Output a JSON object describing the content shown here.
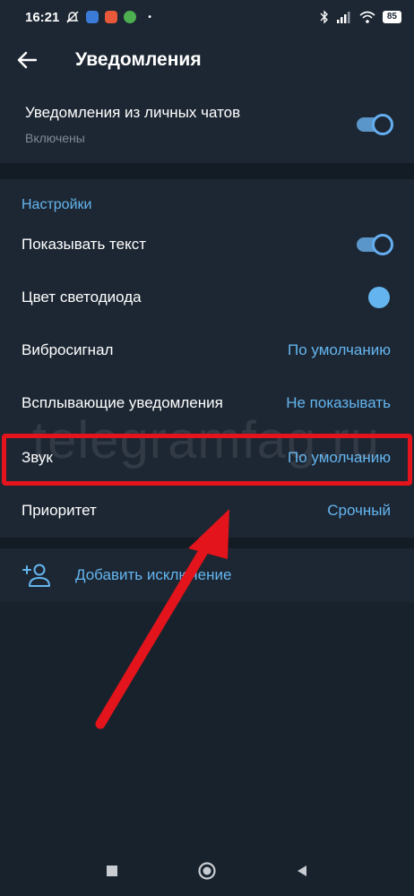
{
  "status_bar": {
    "time": "16:21",
    "battery": "85",
    "app_icon_colors": [
      "#e8593a",
      "#f0b33b",
      "#4caf50"
    ]
  },
  "toolbar": {
    "title": "Уведомления",
    "back_icon": "arrow-left-icon"
  },
  "private_chats": {
    "title": "Уведомления из личных чатов",
    "subtitle": "Включены",
    "enabled": true
  },
  "settings": {
    "header": "Настройки",
    "rows": [
      {
        "label": "Показывать текст",
        "type": "toggle",
        "enabled": true
      },
      {
        "label": "Цвет светодиода",
        "type": "color",
        "color": "#64b5ef"
      },
      {
        "label": "Вибросигнал",
        "type": "value",
        "value": "По умолчанию"
      },
      {
        "label": "Всплывающие уведомления",
        "type": "value",
        "value": "Не показывать"
      },
      {
        "label": "Звук",
        "type": "value",
        "value": "По умолчанию"
      },
      {
        "label": "Приоритет",
        "type": "value",
        "value": "Срочный"
      }
    ]
  },
  "add_exception": {
    "label": "Добавить исключение",
    "icon": "add-user-icon"
  },
  "watermark": "telegramfag.ru",
  "colors": {
    "background": "#18222d",
    "panel": "#1d2733",
    "accent": "#64b5ef",
    "highlight": "#e3141b"
  }
}
